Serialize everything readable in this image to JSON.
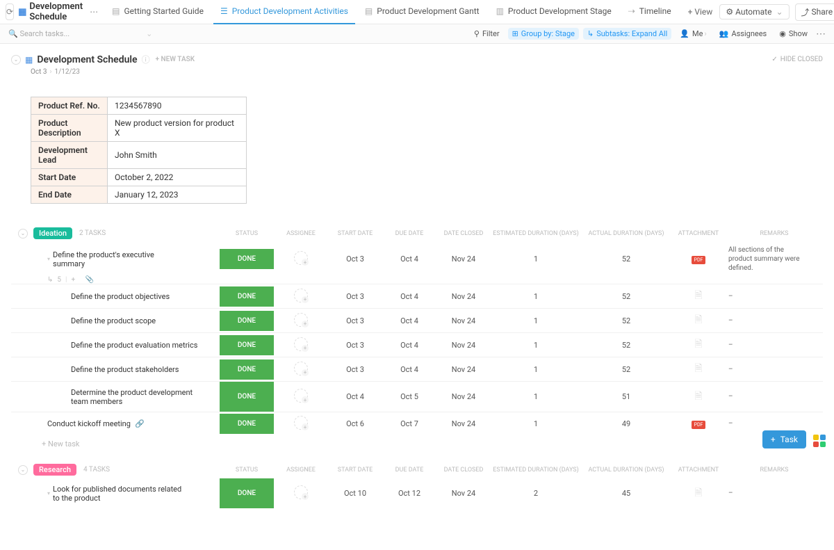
{
  "header": {
    "title": "Development Schedule",
    "tabs": [
      {
        "label": "Getting Started Guide"
      },
      {
        "label": "Product Development Activities"
      },
      {
        "label": "Product Development Gantt"
      },
      {
        "label": "Product Development Stage"
      },
      {
        "label": "Timeline"
      }
    ],
    "add_view": "View",
    "automate": "Automate",
    "share": "Share"
  },
  "filterbar": {
    "search_placeholder": "Search tasks...",
    "filter": "Filter",
    "group_by": "Group by: Stage",
    "subtasks": "Subtasks: Expand All",
    "me": "Me",
    "assignees": "Assignees",
    "show": "Show"
  },
  "page": {
    "title": "Development Schedule",
    "new_task": "+ NEW TASK",
    "hide_closed": "HIDE CLOSED",
    "date_start": "Oct 3",
    "date_end": "1/12/23"
  },
  "info": [
    {
      "k": "Product Ref. No.",
      "v": "1234567890"
    },
    {
      "k": "Product Description",
      "v": "New product version for product X"
    },
    {
      "k": "Development Lead",
      "v": "John Smith"
    },
    {
      "k": "Start Date",
      "v": "October 2, 2022"
    },
    {
      "k": "End Date",
      "v": "January 12, 2023"
    }
  ],
  "columns": [
    "STATUS",
    "ASSIGNEE",
    "START DATE",
    "DUE DATE",
    "DATE CLOSED",
    "ESTIMATED DURATION (DAYS)",
    "ACTUAL DURATION (DAYS)",
    "ATTACHMENT",
    "REMARKS"
  ],
  "groups": [
    {
      "name": "Ideation",
      "count": "2 TASKS",
      "cls": "ideation",
      "tasks": [
        {
          "name": "Define the product's executive summary",
          "status": "DONE",
          "start": "Oct 3",
          "due": "Oct 4",
          "closed": "Nov 24",
          "est": "1",
          "act": "52",
          "attach": "pdf",
          "remarks": "All sections of the product summary were defined.",
          "parent": true,
          "sub_count": "5"
        },
        {
          "name": "Define the product objectives",
          "status": "DONE",
          "start": "Oct 3",
          "due": "Oct 4",
          "closed": "Nov 24",
          "est": "1",
          "act": "52",
          "attach": "doc",
          "remarks": "–",
          "sub": true
        },
        {
          "name": "Define the product scope",
          "status": "DONE",
          "start": "Oct 3",
          "due": "Oct 4",
          "closed": "Nov 24",
          "est": "1",
          "act": "52",
          "attach": "doc",
          "remarks": "–",
          "sub": true
        },
        {
          "name": "Define the product evaluation metrics",
          "status": "DONE",
          "start": "Oct 3",
          "due": "Oct 4",
          "closed": "Nov 24",
          "est": "1",
          "act": "52",
          "attach": "doc",
          "remarks": "–",
          "sub": true
        },
        {
          "name": "Define the product stakeholders",
          "status": "DONE",
          "start": "Oct 3",
          "due": "Oct 4",
          "closed": "Nov 24",
          "est": "1",
          "act": "52",
          "attach": "doc",
          "remarks": "–",
          "sub": true
        },
        {
          "name": "Determine the product development team members",
          "status": "DONE",
          "start": "Oct 4",
          "due": "Oct 5",
          "closed": "Nov 24",
          "est": "1",
          "act": "51",
          "attach": "doc",
          "remarks": "–",
          "sub": true,
          "tall": true
        },
        {
          "name": "Conduct kickoff meeting",
          "status": "DONE",
          "start": "Oct 6",
          "due": "Oct 7",
          "closed": "Nov 24",
          "est": "1",
          "act": "49",
          "attach": "pdf",
          "remarks": "–",
          "milestone": true
        }
      ],
      "new_task": "+ New task"
    },
    {
      "name": "Research",
      "count": "4 TASKS",
      "cls": "research",
      "tasks": [
        {
          "name": "Look for published documents related to the product",
          "status": "DONE",
          "start": "Oct 10",
          "due": "Oct 12",
          "closed": "Nov 24",
          "est": "2",
          "act": "45",
          "attach": "doc",
          "remarks": "–",
          "parent": true,
          "tall": true
        }
      ]
    }
  ],
  "float_task": "Task"
}
